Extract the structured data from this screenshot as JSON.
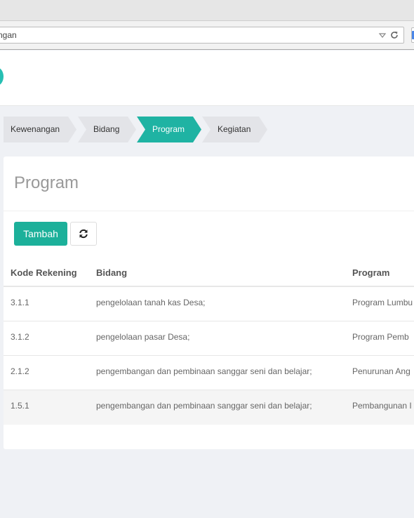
{
  "browser": {
    "url_fragment": "ngan"
  },
  "steps": [
    {
      "label": "Kewenangan",
      "active": false
    },
    {
      "label": "Bidang",
      "active": false
    },
    {
      "label": "Program",
      "active": true
    },
    {
      "label": "Kegiatan",
      "active": false
    }
  ],
  "panel": {
    "title": "Program",
    "add_label": "Tambah",
    "refresh_icon": "refresh-icon"
  },
  "table": {
    "headers": [
      "Kode Rekening",
      "Bidang",
      "Program"
    ],
    "rows": [
      [
        "3.1.1",
        "pengelolaan tanah kas Desa;",
        "Program Lumbu"
      ],
      [
        "3.1.2",
        "pengelolaan pasar Desa;",
        "Program Pemb"
      ],
      [
        "2.1.2",
        "pengembangan dan pembinaan sanggar seni dan belajar;",
        "Penurunan Ang"
      ],
      [
        "1.5.1",
        "pengembangan dan pembinaan sanggar seni dan belajar;",
        "Pembangunan I"
      ]
    ]
  },
  "colors": {
    "accent": "#1cb09a",
    "step_inactive": "#e3e4e8",
    "step_active": "#1fb3a3"
  }
}
